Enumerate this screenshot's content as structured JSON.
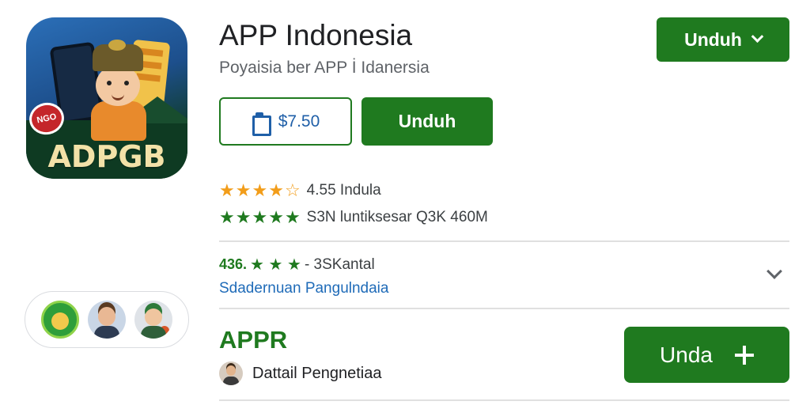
{
  "app": {
    "title": "APP Indonesia",
    "subtitle": "Poyaisia ber APP İ Idanersia",
    "icon_label": "ADPGB",
    "icon_badge": "NGO"
  },
  "buttons": {
    "top_download": "Unduh",
    "price": "$7.50",
    "download": "Unduh",
    "bottom_download": "Unda"
  },
  "ratings": {
    "row1": {
      "stars_filled": 4,
      "stars_total": 5,
      "text": "4.55 Indula"
    },
    "row2": {
      "stars_filled": 5,
      "stars_total": 5,
      "text": "S3N luntiksesar Q3K 460M"
    }
  },
  "reviews": {
    "score": "436.",
    "stars": "★ ★ ★",
    "count_text": "- 3SKantal",
    "link": "Sdadernuan Pangulndaia"
  },
  "section": {
    "heading": "APPR",
    "detail": "Dattail Pengnetiaa"
  },
  "colors": {
    "accent_green": "#1f7a1f",
    "star_orange": "#f29d1a",
    "link_blue": "#1f6bb8"
  },
  "icons": [
    "chevron-down-icon",
    "clipboard-icon",
    "star-icon",
    "chevron-expand-icon",
    "plus-icon",
    "avatar-icon"
  ]
}
